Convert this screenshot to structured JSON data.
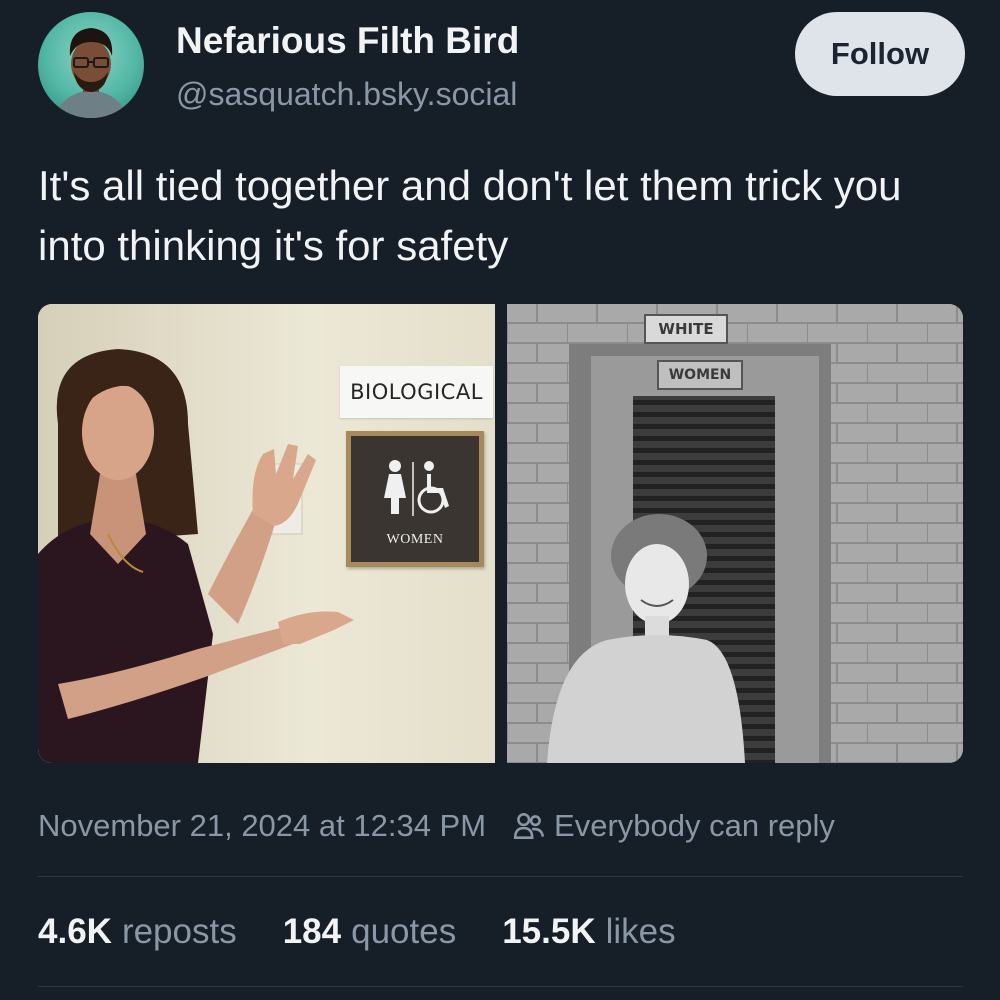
{
  "author": {
    "name": "Nefarious Filth Bird",
    "handle": "@sasquatch.bsky.social",
    "avatar_icon": "avatar-image"
  },
  "follow_label": "Follow",
  "post": {
    "text": "It's all tied together and don't let them trick you into thinking it's for safety"
  },
  "images": {
    "left": {
      "label_text": "BIOLOGICAL",
      "sign_text": "WOMEN"
    },
    "right": {
      "sign_top": "WHITE",
      "sign_bottom": "WOMEN"
    }
  },
  "meta": {
    "timestamp": "November 21, 2024 at 12:34 PM",
    "reply_setting": "Everybody can reply",
    "reply_icon": "people-icon"
  },
  "stats": {
    "reposts_count": "4.6K",
    "reposts_label": "reposts",
    "quotes_count": "184",
    "quotes_label": "quotes",
    "likes_count": "15.5K",
    "likes_label": "likes"
  },
  "colors": {
    "background": "#161e27",
    "text_primary": "#f1f3f5",
    "text_secondary": "#8a97a6",
    "follow_bg": "#dfe4ea"
  }
}
